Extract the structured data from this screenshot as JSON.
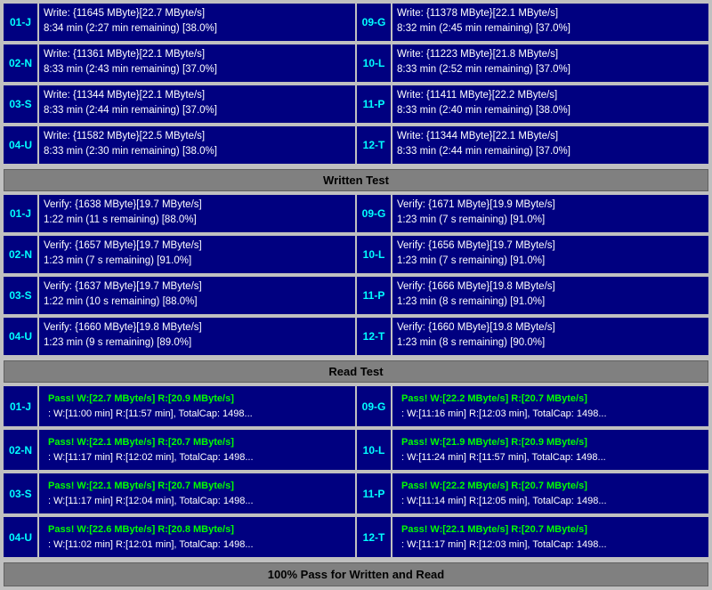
{
  "sections": {
    "write": {
      "header": "Written Test",
      "left": [
        {
          "id": "01-J",
          "line1": "Write: {11645 MByte}[22.7 MByte/s]",
          "line2": "8:34 min (2:27 min remaining)  [38.0%]"
        },
        {
          "id": "02-N",
          "line1": "Write: {11361 MByte}[22.1 MByte/s]",
          "line2": "8:33 min (2:43 min remaining)  [37.0%]"
        },
        {
          "id": "03-S",
          "line1": "Write: {11344 MByte}[22.1 MByte/s]",
          "line2": "8:33 min (2:44 min remaining)  [37.0%]"
        },
        {
          "id": "04-U",
          "line1": "Write: {11582 MByte}[22.5 MByte/s]",
          "line2": "8:33 min (2:30 min remaining)  [38.0%]"
        }
      ],
      "right": [
        {
          "id": "09-G",
          "line1": "Write: {11378 MByte}[22.1 MByte/s]",
          "line2": "8:32 min (2:45 min remaining)  [37.0%]"
        },
        {
          "id": "10-L",
          "line1": "Write: {11223 MByte}[21.8 MByte/s]",
          "line2": "8:33 min (2:52 min remaining)  [37.0%]"
        },
        {
          "id": "11-P",
          "line1": "Write: {11411 MByte}[22.2 MByte/s]",
          "line2": "8:33 min (2:40 min remaining)  [38.0%]"
        },
        {
          "id": "12-T",
          "line1": "Write: {11344 MByte}[22.1 MByte/s]",
          "line2": "8:33 min (2:44 min remaining)  [37.0%]"
        }
      ]
    },
    "verify": {
      "left": [
        {
          "id": "01-J",
          "line1": "Verify: {1638 MByte}[19.7 MByte/s]",
          "line2": "1:22 min (11 s remaining)  [88.0%]"
        },
        {
          "id": "02-N",
          "line1": "Verify: {1657 MByte}[19.7 MByte/s]",
          "line2": "1:23 min (7 s remaining)  [91.0%]"
        },
        {
          "id": "03-S",
          "line1": "Verify: {1637 MByte}[19.7 MByte/s]",
          "line2": "1:22 min (10 s remaining)  [88.0%]"
        },
        {
          "id": "04-U",
          "line1": "Verify: {1660 MByte}[19.8 MByte/s]",
          "line2": "1:23 min (9 s remaining)  [89.0%]"
        }
      ],
      "right": [
        {
          "id": "09-G",
          "line1": "Verify: {1671 MByte}[19.9 MByte/s]",
          "line2": "1:23 min (7 s remaining)  [91.0%]"
        },
        {
          "id": "10-L",
          "line1": "Verify: {1656 MByte}[19.7 MByte/s]",
          "line2": "1:23 min (7 s remaining)  [91.0%]"
        },
        {
          "id": "11-P",
          "line1": "Verify: {1666 MByte}[19.8 MByte/s]",
          "line2": "1:23 min (8 s remaining)  [91.0%]"
        },
        {
          "id": "12-T",
          "line1": "Verify: {1660 MByte}[19.8 MByte/s]",
          "line2": "1:23 min (8 s remaining)  [90.0%]"
        }
      ]
    },
    "read": {
      "header": "Read Test",
      "left": [
        {
          "id": "01-J",
          "line1": "Pass! W:[22.7 MByte/s] R:[20.9 MByte/s]",
          "line2": ": W:[11:00 min] R:[11:57 min], TotalCap: 1498..."
        },
        {
          "id": "02-N",
          "line1": "Pass! W:[22.1 MByte/s] R:[20.7 MByte/s]",
          "line2": ": W:[11:17 min] R:[12:02 min], TotalCap: 1498..."
        },
        {
          "id": "03-S",
          "line1": "Pass! W:[22.1 MByte/s] R:[20.7 MByte/s]",
          "line2": ": W:[11:17 min] R:[12:04 min], TotalCap: 1498..."
        },
        {
          "id": "04-U",
          "line1": "Pass! W:[22.6 MByte/s] R:[20.8 MByte/s]",
          "line2": ": W:[11:02 min] R:[12:01 min], TotalCap: 1498..."
        }
      ],
      "right": [
        {
          "id": "09-G",
          "line1": "Pass! W:[22.2 MByte/s] R:[20.7 MByte/s]",
          "line2": ": W:[11:16 min] R:[12:03 min], TotalCap: 1498..."
        },
        {
          "id": "10-L",
          "line1": "Pass! W:[21.9 MByte/s] R:[20.9 MByte/s]",
          "line2": ": W:[11:24 min] R:[11:57 min], TotalCap: 1498..."
        },
        {
          "id": "11-P",
          "line1": "Pass! W:[22.2 MByte/s] R:[20.7 MByte/s]",
          "line2": ": W:[11:14 min] R:[12:05 min], TotalCap: 1498..."
        },
        {
          "id": "12-T",
          "line1": "Pass! W:[22.1 MByte/s] R:[20.7 MByte/s]",
          "line2": ": W:[11:17 min] R:[12:03 min], TotalCap: 1498..."
        }
      ]
    }
  },
  "labels": {
    "written_test": "Written Test",
    "read_test": "Read Test",
    "bottom_status": "100% Pass for Written and Read"
  }
}
